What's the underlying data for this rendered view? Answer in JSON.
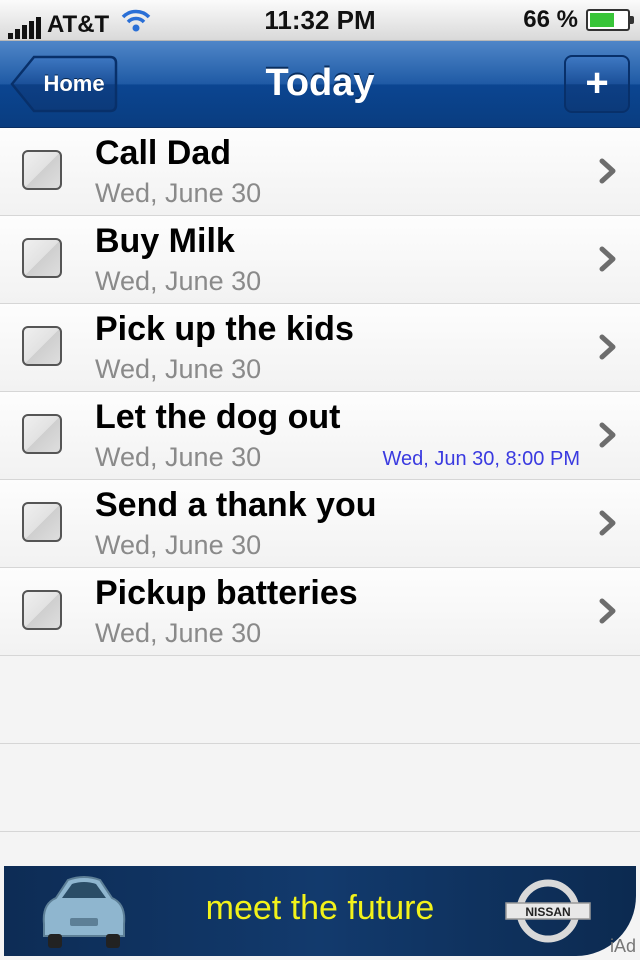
{
  "status_bar": {
    "carrier": "AT&T",
    "time": "11:32 PM",
    "battery": "66 %",
    "battery_level": 0.66
  },
  "nav": {
    "back_label": "Home",
    "title": "Today",
    "add_label": "+"
  },
  "tasks": [
    {
      "title": "Call Dad",
      "date": "Wed, June 30",
      "reminder": ""
    },
    {
      "title": "Buy Milk",
      "date": "Wed, June 30",
      "reminder": ""
    },
    {
      "title": "Pick up the kids",
      "date": "Wed, June 30",
      "reminder": ""
    },
    {
      "title": "Let the dog out",
      "date": "Wed, June 30",
      "reminder": "Wed, Jun 30, 8:00 PM"
    },
    {
      "title": "Send a thank you",
      "date": "Wed, June 30",
      "reminder": ""
    },
    {
      "title": "Pickup batteries",
      "date": "Wed, June 30",
      "reminder": ""
    }
  ],
  "ad": {
    "text": "meet the future",
    "brand": "NISSAN",
    "badge": "iAd",
    "text_color": "#f2f21a"
  }
}
